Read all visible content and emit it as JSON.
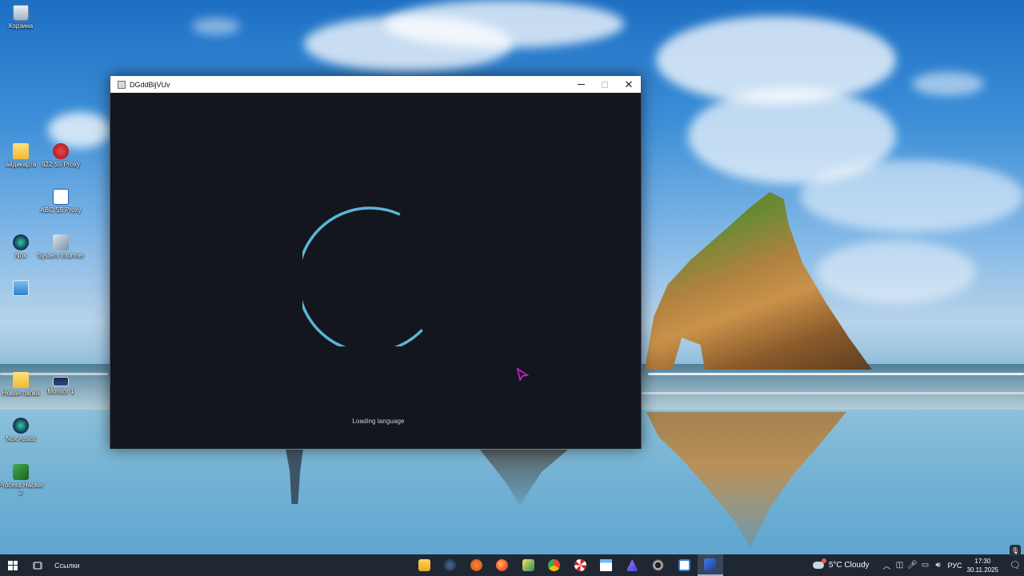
{
  "desktop": {
    "icons": [
      {
        "label": "Корзина",
        "icon": "recycle-bin-icon"
      },
      {
        "label": "айдикарта",
        "icon": "folder-icon"
      },
      {
        "label": "922 S5 Proxy",
        "icon": "922-proxy-icon"
      },
      {
        "label": "ABC S5 Proxy",
        "icon": "abc-proxy-icon"
      },
      {
        "label": "Nox",
        "icon": "nox-icon"
      },
      {
        "label": "System Informer",
        "icon": "system-informer-icon"
      },
      {
        "label": "",
        "icon": "screenshot-icon"
      },
      {
        "label": "Новая папка",
        "icon": "folder-icon"
      },
      {
        "label": "Monitor 1",
        "icon": "monitor-icon"
      },
      {
        "label": "Nox Assist",
        "icon": "nox-assist-icon"
      },
      {
        "label": "Process Hacker 2",
        "icon": "process-hacker-icon"
      }
    ]
  },
  "window": {
    "title": "DGddBijVUv",
    "loading_text": "Loading language",
    "spinner_color": "#5bb5d8",
    "background": "#13161d"
  },
  "taskbar": {
    "links_label": "Ссылки",
    "weather": "5°C  Cloudy",
    "language": "РУС",
    "time": "17:30",
    "date": "30.11.2025",
    "notifications_count": "5",
    "apps": [
      "file-explorer-icon",
      "steam-icon",
      "app-orange-icon",
      "firefox-icon",
      "archive-icon",
      "chrome-icon",
      "umbrella-icon",
      "window-app-icon",
      "app-badge-icon",
      "record-icon",
      "notepad-icon",
      "terminal-icon"
    ]
  }
}
